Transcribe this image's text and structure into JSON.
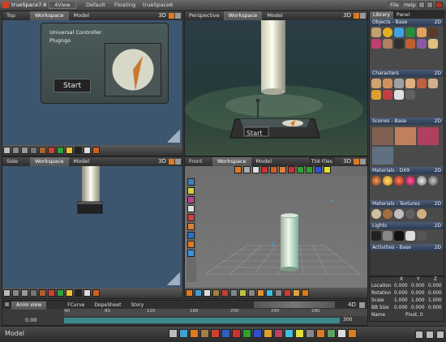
{
  "title_bar": {
    "app_name": "trueSpace7.6",
    "tabs": [
      "4View",
      "Default",
      "Floating",
      "trueSpace6"
    ],
    "menus": [
      "File",
      "Help"
    ]
  },
  "viewports": {
    "top": {
      "name": "Top",
      "tabs": [
        "Workspace",
        "Model"
      ],
      "badge": "3D",
      "panel_title_1": "Universal Controller",
      "panel_title_2": "Plugngo",
      "start_label": "Start"
    },
    "perspective": {
      "name": "Perspective",
      "tabs": [
        "Workspace",
        "Model"
      ],
      "badge": "3D",
      "start_label": "Start"
    },
    "side": {
      "name": "Side",
      "tabs": [
        "Workspace",
        "Model"
      ],
      "badge": "3D"
    },
    "front": {
      "name": "Front",
      "tabs": [
        "Workspace",
        "Model"
      ],
      "ts6_files": "TS6 Files",
      "badge": "3D"
    }
  },
  "library": {
    "tabs": [
      "Library",
      "Panel"
    ],
    "sections": [
      {
        "title": "Objects - Base",
        "badge": "2D"
      },
      {
        "title": "Characters",
        "badge": "2D"
      },
      {
        "title": "Scenes - Base",
        "badge": "2D"
      },
      {
        "title": "Materials - DX9",
        "badge": "2D"
      },
      {
        "title": "Materials - Textures",
        "badge": "2D"
      },
      {
        "title": "Lights",
        "badge": "2D"
      },
      {
        "title": "Activities - Base",
        "badge": "2D"
      }
    ]
  },
  "properties": {
    "headers": [
      "X",
      "Y",
      "Z"
    ],
    "rows": [
      {
        "label": "Location",
        "values": [
          "0.000",
          "0.000",
          "0.000"
        ]
      },
      {
        "label": "Rotation",
        "values": [
          "0.000",
          "0.000",
          "0.000"
        ]
      },
      {
        "label": "Scale",
        "values": [
          "1.000",
          "1.000",
          "1.000"
        ]
      },
      {
        "label": "BB Size",
        "values": [
          "0.000",
          "0.000",
          "0.000"
        ]
      }
    ],
    "name_label": "Name",
    "name_value": "Pivot, 0"
  },
  "timeline": {
    "tabs": [
      "Anim view",
      "FCurve",
      "DopeSheet",
      "Story"
    ],
    "ticks": [
      "40",
      "80",
      "120",
      "180",
      "200",
      "240",
      "280"
    ],
    "frame_value": "0.00",
    "end_value": "300",
    "badge": "4D"
  },
  "status_bar": {
    "mode": "Model"
  },
  "colors": {
    "viewport_bg": "#3d5670",
    "accent_orange": "#e07a20",
    "panel_bg": "#3a3a3a"
  }
}
